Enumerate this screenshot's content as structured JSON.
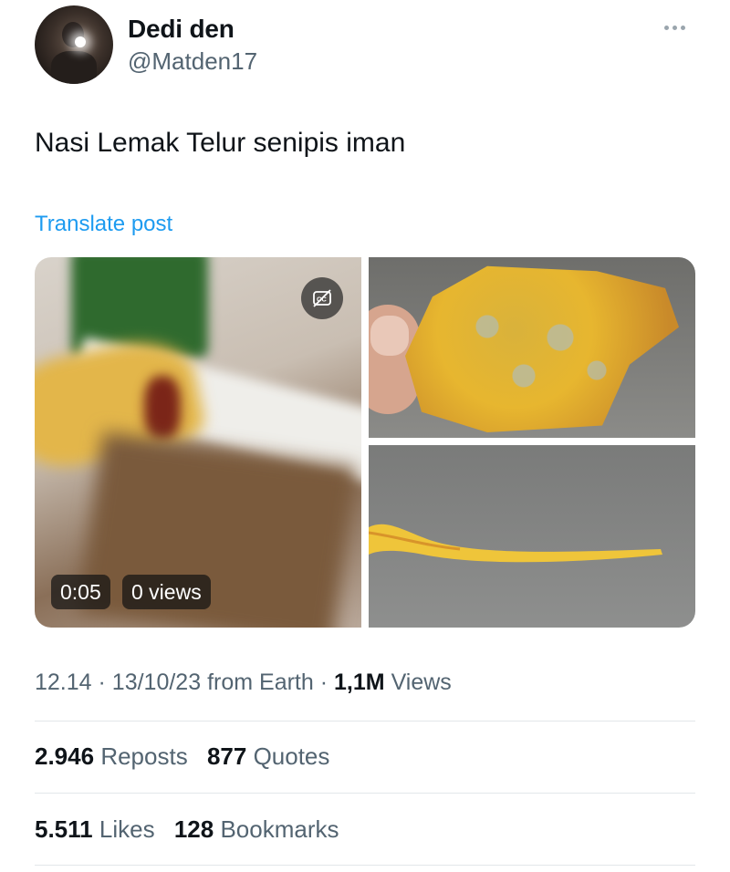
{
  "author": {
    "display_name": "Dedi den",
    "handle": "@Matden17"
  },
  "tweet": {
    "text": "Nasi Lemak Telur senipis iman",
    "translate_label": "Translate post"
  },
  "media": {
    "video": {
      "duration": "0:05",
      "views": "0 views"
    }
  },
  "meta": {
    "time": "12.14",
    "sep1": "·",
    "date": "13/10/23",
    "source": "from Earth",
    "sep2": "·",
    "views_count": "1,1M",
    "views_label": "Views"
  },
  "stats": {
    "reposts_count": "2.946",
    "reposts_label": "Reposts",
    "quotes_count": "877",
    "quotes_label": "Quotes",
    "likes_count": "5.511",
    "likes_label": "Likes",
    "bookmarks_count": "128",
    "bookmarks_label": "Bookmarks"
  },
  "colors": {
    "link": "#1d9bf0",
    "text_primary": "#0f1419",
    "text_secondary": "#536471",
    "divider": "#e3e7ea"
  }
}
